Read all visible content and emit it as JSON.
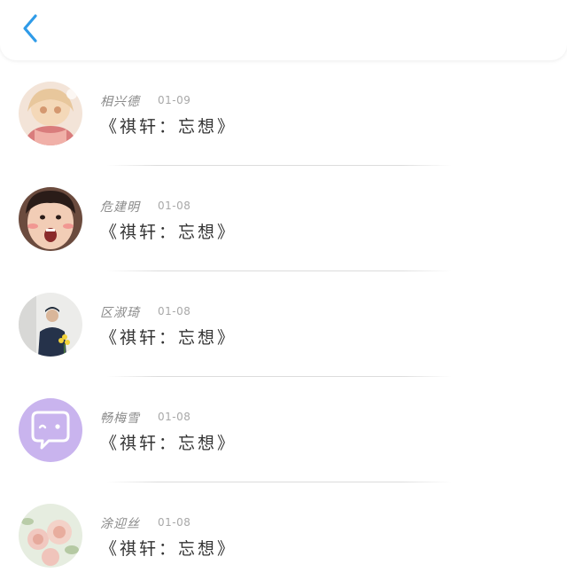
{
  "header": {
    "back_icon": "chevron-left-icon",
    "accent_color": "#2f9be8"
  },
  "messages": [
    {
      "name": "相兴德",
      "date": "01-09",
      "text": "《祺轩：忘想》",
      "avatar": "anime-girl-avatar"
    },
    {
      "name": "危建明",
      "date": "01-08",
      "text": "《祺轩：忘想》",
      "avatar": "boy-face-avatar"
    },
    {
      "name": "区淑琦",
      "date": "01-08",
      "text": "《祺轩：忘想》",
      "avatar": "person-with-flowers-avatar"
    },
    {
      "name": "畅梅雪",
      "date": "01-08",
      "text": "《祺轩：忘想》",
      "avatar": "purple-chat-bubble-avatar"
    },
    {
      "name": "涂迎丝",
      "date": "01-08",
      "text": "《祺轩：忘想》",
      "avatar": "roses-avatar"
    }
  ]
}
